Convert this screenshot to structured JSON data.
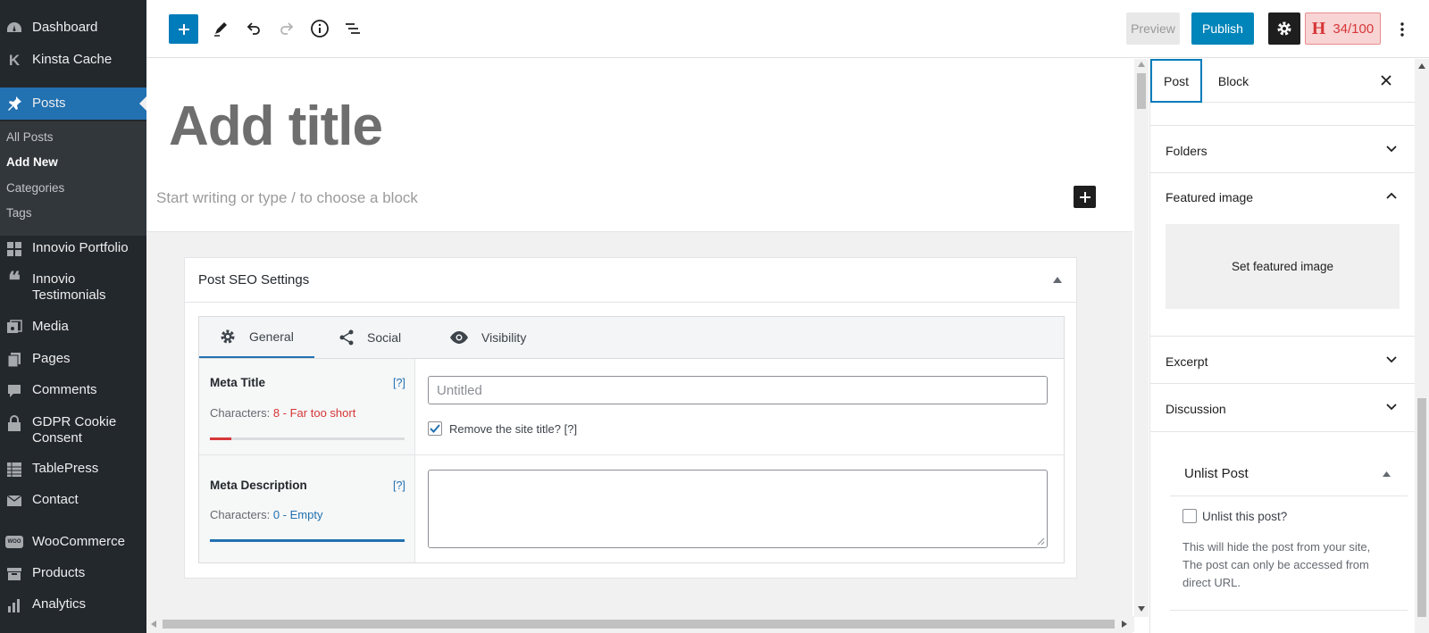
{
  "sidebar": {
    "items": [
      {
        "key": "dashboard",
        "label": "Dashboard",
        "icon": "dashboard-icon"
      },
      {
        "key": "kinsta",
        "label": "Kinsta Cache",
        "icon": "kinsta-icon"
      },
      {
        "key": "posts",
        "label": "Posts",
        "icon": "pin-icon"
      },
      {
        "key": "portfolio",
        "label": "Innovio Portfolio",
        "icon": "grid-icon"
      },
      {
        "key": "testimonials",
        "label": "Innovio Testimonials",
        "icon": "quote-icon"
      },
      {
        "key": "media",
        "label": "Media",
        "icon": "media-icon"
      },
      {
        "key": "pages",
        "label": "Pages",
        "icon": "pages-icon"
      },
      {
        "key": "comments",
        "label": "Comments",
        "icon": "comment-icon"
      },
      {
        "key": "gdpr",
        "label": "GDPR Cookie Consent",
        "icon": "lock-icon"
      },
      {
        "key": "tablepress",
        "label": "TablePress",
        "icon": "table-icon"
      },
      {
        "key": "contact",
        "label": "Contact",
        "icon": "mail-icon"
      },
      {
        "key": "woocommerce",
        "label": "WooCommerce",
        "icon": "woo-icon"
      },
      {
        "key": "products",
        "label": "Products",
        "icon": "box-icon"
      },
      {
        "key": "analytics",
        "label": "Analytics",
        "icon": "bar-chart-icon"
      }
    ],
    "sub": [
      "All Posts",
      "Add New",
      "Categories",
      "Tags"
    ]
  },
  "toolbar": {
    "preview": "Preview",
    "publish": "Publish",
    "score": "34/100"
  },
  "editor": {
    "title_placeholder": "Add title",
    "block_placeholder": "Start writing or type / to choose a block"
  },
  "seo": {
    "heading": "Post SEO Settings",
    "tabs": [
      "General",
      "Social",
      "Visibility"
    ],
    "meta_title": {
      "label": "Meta Title",
      "help": "[?]",
      "chars_label": "Characters:",
      "chars_value": "8 - Far too short",
      "placeholder": "Untitled",
      "remove_label": "Remove the site title? [?]",
      "progress": 0.11,
      "color": "#d63638"
    },
    "meta_desc": {
      "label": "Meta Description",
      "help": "[?]",
      "chars_label": "Characters:",
      "chars_value": "0 - Empty",
      "progress": 1.0,
      "color": "#2271b1"
    }
  },
  "settings": {
    "tabs": [
      "Post",
      "Block"
    ],
    "sections": [
      "Folders",
      "Featured image",
      "Excerpt",
      "Discussion"
    ],
    "featured_button": "Set featured image",
    "unlist": {
      "title": "Unlist Post",
      "checkbox": "Unlist this post?",
      "desc1": "This will hide the post from your site,",
      "desc2": "The post can only be accessed from",
      "desc3": "direct URL."
    }
  }
}
